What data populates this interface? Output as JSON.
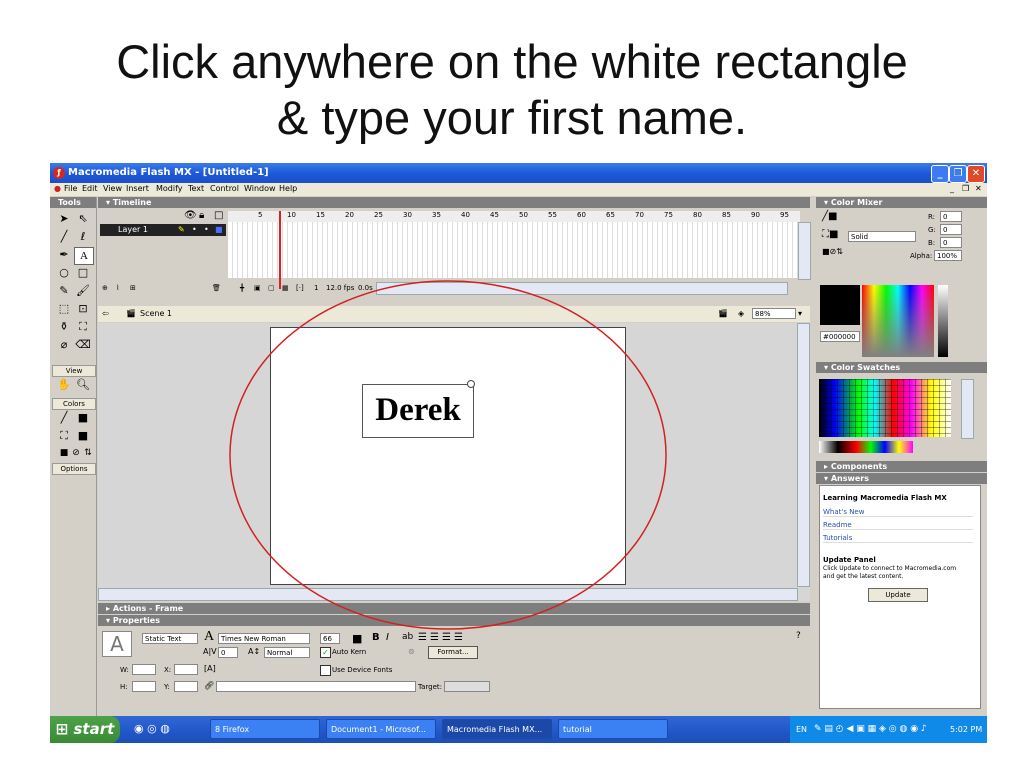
{
  "slide": {
    "title_line1": "Click anywhere on the white rectangle",
    "title_line2": "& type your first name."
  },
  "window": {
    "title": "Macromedia Flash MX - [Untitled-1]"
  },
  "menu": [
    "File",
    "Edit",
    "View",
    "Insert",
    "Modify",
    "Text",
    "Control",
    "Window",
    "Help"
  ],
  "tools": {
    "header": "Tools",
    "view_label": "View",
    "colors_label": "Colors",
    "options_label": "Options"
  },
  "timeline": {
    "header": "Timeline",
    "layer_name": "Layer 1",
    "frame_numbers": [
      "5",
      "10",
      "15",
      "20",
      "25",
      "30",
      "35",
      "40",
      "45",
      "50",
      "55",
      "60",
      "65",
      "70",
      "75",
      "80",
      "85",
      "90",
      "95"
    ],
    "current_frame": "1",
    "fps": "12.0 fps",
    "time": "0.0s"
  },
  "scene": {
    "name": "Scene 1",
    "zoom": "88%"
  },
  "stage": {
    "typed_text": "Derek"
  },
  "actions": {
    "header": "Actions - Frame"
  },
  "properties": {
    "header": "Properties",
    "text_type": "Static Text",
    "font": "Times New Roman",
    "size": "66",
    "bold": "B",
    "italic": "I",
    "tracking": "0",
    "position": "Normal",
    "auto_kern": "Auto Kern",
    "format_button": "Format...",
    "use_device_fonts": "Use Device Fonts",
    "w_label": "W:",
    "x_label": "X:",
    "h_label": "H:",
    "y_label": "Y:",
    "target_label": "Target:"
  },
  "color_mixer": {
    "header": "Color Mixer",
    "fill_style": "Solid",
    "r_label": "R:",
    "r": "0",
    "g_label": "G:",
    "g": "0",
    "b_label": "B:",
    "b": "0",
    "alpha_label": "Alpha:",
    "alpha": "100%",
    "hex": "#000000"
  },
  "color_swatches": {
    "header": "Color Swatches"
  },
  "components": {
    "header": "Components"
  },
  "answers": {
    "header": "Answers",
    "heading": "Learning Macromedia Flash MX",
    "links": [
      "What's New",
      "Readme",
      "Tutorials"
    ],
    "update_title": "Update Panel",
    "update_text_1": "Click Update to connect to Macromedia.com",
    "update_text_2": "and get the latest content.",
    "update_button": "Update"
  },
  "taskbar": {
    "start": "start",
    "items": [
      "8 Firefox",
      "Document1 - Microsof...",
      "Macromedia Flash MX...",
      "tutorial"
    ],
    "lang": "EN",
    "clock": "5:02 PM"
  },
  "colors": {
    "accent": "#1c57d9",
    "stage_bg": "#ffffff",
    "ellipse": "#d22020"
  }
}
